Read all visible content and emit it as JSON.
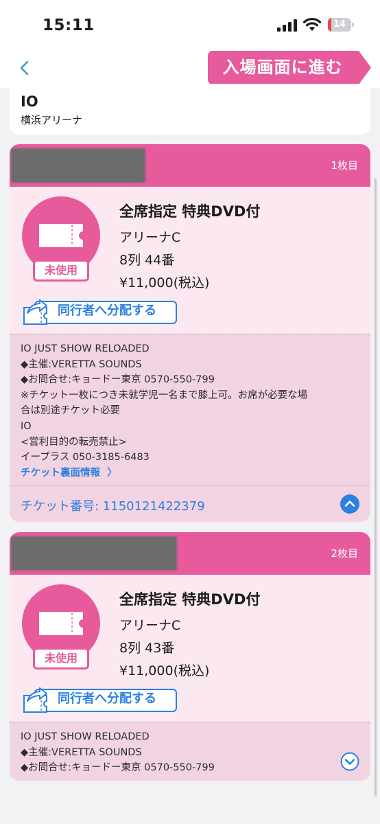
{
  "status_bar": {
    "time": "15:11",
    "battery": "14",
    "battery_level": 0.14
  },
  "nav": {
    "enter_button": "入場画面に進む"
  },
  "event": {
    "name": "IO",
    "venue": "横浜アリーナ"
  },
  "tickets": [
    {
      "count_label": "1枚目",
      "badge": "未使用",
      "seat_type": "全席指定 特典DVD付",
      "area": "アリーナC",
      "seat": "8列 44番",
      "price": "¥11,000(税込)",
      "share_label": "同行者へ分配する",
      "notes": [
        "IO JUST SHOW RELOADED",
        "◆主催:VERETTA SOUNDS",
        "◆お問合せ:キョードー東京 0570-550-799",
        "※チケット一枚につき未就学児一名まで膝上可。お席が必要な場",
        "合は別途チケット必要",
        "IO",
        "<営利目的の転売禁止>",
        "イープラス 050-3185-6483"
      ],
      "back_info_link": "チケット裏面情報",
      "ticket_number": "チケット番号: 1150121422379"
    },
    {
      "count_label": "2枚目",
      "badge": "未使用",
      "seat_type": "全席指定 特典DVD付",
      "area": "アリーナC",
      "seat": "8列 43番",
      "price": "¥11,000(税込)",
      "share_label": "同行者へ分配する",
      "notes": [
        "IO JUST SHOW RELOADED",
        "◆主催:VERETTA SOUNDS",
        "◆お問合せ:キョードー東京 0570-550-799"
      ]
    }
  ],
  "colors": {
    "pink": "#e75a9c",
    "ticket_bg": "#fce8f1",
    "notes_bg": "#f2d3e1",
    "link_blue": "#2b80e0"
  }
}
